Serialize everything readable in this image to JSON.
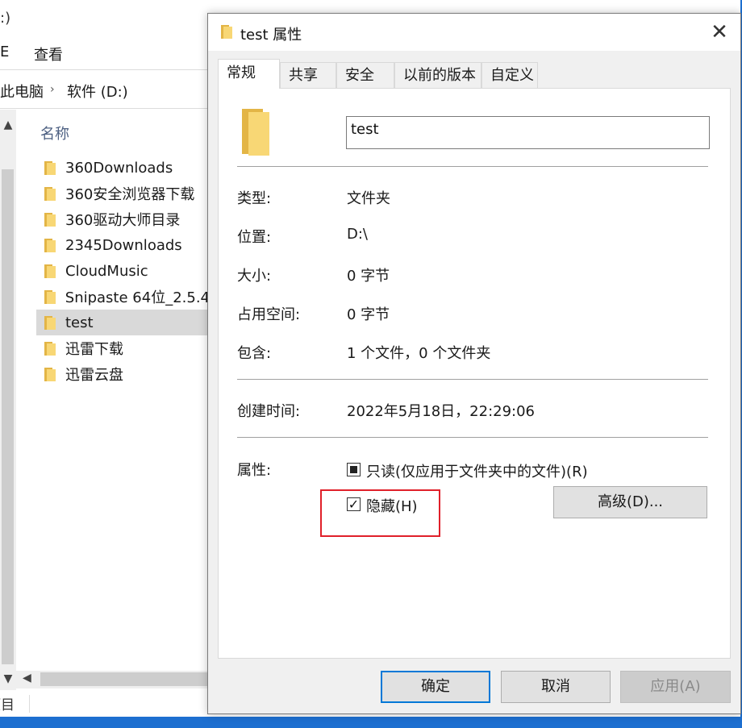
{
  "explorer": {
    "title_fragment": ":)",
    "ribbon_tab": "查看",
    "ribbon_tab_partial": "E",
    "breadcrumb": [
      "此电脑",
      "软件 (D:)"
    ],
    "column_header": "名称",
    "files": [
      {
        "name": "360Downloads"
      },
      {
        "name": "360安全浏览器下载"
      },
      {
        "name": "360驱动大师目录"
      },
      {
        "name": "2345Downloads"
      },
      {
        "name": "CloudMusic"
      },
      {
        "name": "Snipaste 64位_2.5.4"
      },
      {
        "name": "test",
        "selected": true
      },
      {
        "name": "迅雷下载"
      },
      {
        "name": "迅雷云盘"
      }
    ],
    "status_fragment": "项目"
  },
  "dialog": {
    "title": "test 属性",
    "close_glyph": "✕",
    "tabs": [
      "常规",
      "共享",
      "安全",
      "以前的版本",
      "自定义"
    ],
    "active_tab": "常规",
    "folder_name": "test",
    "props": {
      "type_label": "类型:",
      "type_value": "文件夹",
      "location_label": "位置:",
      "location_value": "D:\\",
      "size_label": "大小:",
      "size_value": "0 字节",
      "disk_label": "占用空间:",
      "disk_value": "0 字节",
      "contains_label": "包含:",
      "contains_value": "1 个文件，0 个文件夹",
      "created_label": "创建时间:",
      "created_value": "2022年5月18日，22:29:06",
      "attributes_label": "属性:"
    },
    "attributes": {
      "readonly_label": "只读(仅应用于文件夹中的文件)(R)",
      "readonly_state": "indeterminate",
      "hidden_label": "隐藏(H)",
      "hidden_state": "checked",
      "advanced_label": "高级(D)..."
    },
    "buttons": {
      "ok": "确定",
      "cancel": "取消",
      "apply": "应用(A)"
    },
    "highlight_color": "#e0202a"
  }
}
